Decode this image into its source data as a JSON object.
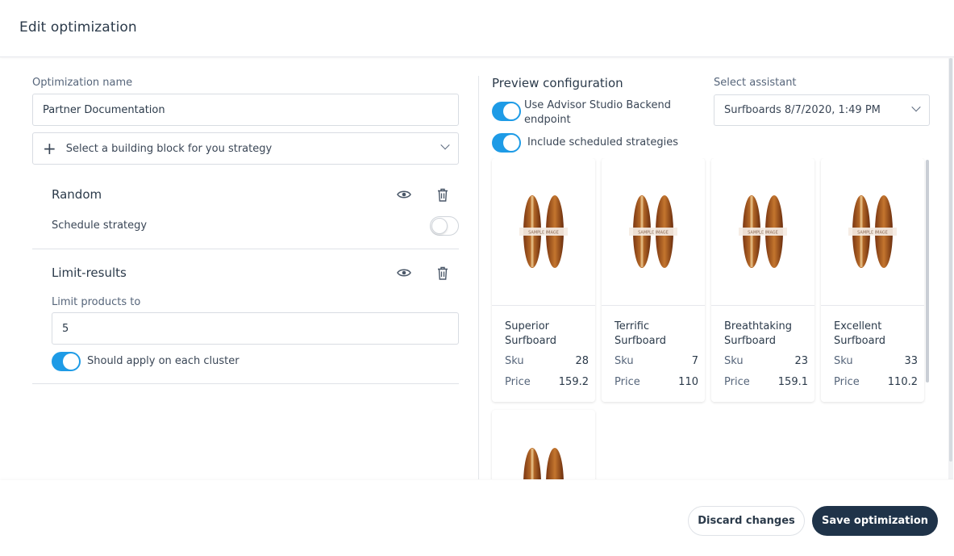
{
  "header": {
    "title": "Edit optimization"
  },
  "left": {
    "name_label": "Optimization name",
    "name_value": "Partner Documentation",
    "building_block_placeholder": "Select a building block for you strategy",
    "blocks": [
      {
        "title": "Random",
        "schedule_label": "Schedule strategy",
        "schedule_on": false
      },
      {
        "title": "Limit-results",
        "limit_label": "Limit products to",
        "limit_value": "5",
        "cluster_label": "Should apply on each cluster",
        "cluster_on": true
      }
    ]
  },
  "preview": {
    "title": "Preview configuration",
    "options": [
      {
        "label": "Use Advisor Studio Backend endpoint",
        "on": true
      },
      {
        "label": "Include scheduled strategies",
        "on": true
      }
    ],
    "assistant_label": "Select assistant",
    "assistant_value": "Surfboards 8/7/2020, 1:49 PM",
    "image_text": "SAMPLE IMAGE",
    "products": [
      {
        "name": "Superior Surfboard",
        "sku_label": "Sku",
        "sku": "28",
        "price_label": "Price",
        "price": "159.2"
      },
      {
        "name": "Terrific Surfboard",
        "sku_label": "Sku",
        "sku": "7",
        "price_label": "Price",
        "price": "110"
      },
      {
        "name": "Breathtaking Surfboard",
        "sku_label": "Sku",
        "sku": "23",
        "price_label": "Price",
        "price": "159.1"
      },
      {
        "name": "Excellent Surfboard",
        "sku_label": "Sku",
        "sku": "33",
        "price_label": "Price",
        "price": "110.2"
      }
    ]
  },
  "footer": {
    "discard_label": "Discard changes",
    "save_label": "Save optimization"
  },
  "colors": {
    "accent": "#1e9be6",
    "primary_button": "#1f3349"
  }
}
